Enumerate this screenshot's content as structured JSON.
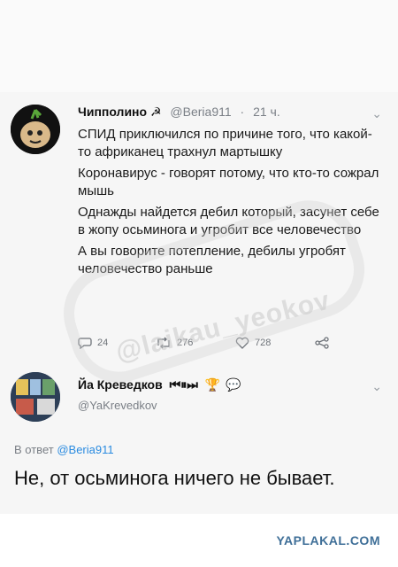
{
  "tweet1": {
    "name": "Чипполино",
    "handle": "@Beria911",
    "dot": "·",
    "time": "21 ч.",
    "lines": [
      "СПИД приключился  по причине того, что какой-то африканец трахнул мартышку",
      "Коронавирус - говорят потому, что кто-то сожрал мышь",
      "Однажды найдется дебил который, засунет себе в жопу осьминога и угробит все человечество",
      "А вы говорите потепление, дебилы угробят человечество раньше"
    ],
    "replies": "24",
    "retweets": "276",
    "likes": "728"
  },
  "tweet2": {
    "name": "Йа Креведков",
    "handle": "@YaKrevedkov",
    "reply_prefix": "В ответ",
    "reply_to": "@Beria911",
    "text": "Не, от осьминога ничего не бывает."
  },
  "watermark": "@laikau_yeokov",
  "site": "YAPLAKAL.COM",
  "icons": {
    "reply": "reply-icon",
    "retweet": "retweet-icon",
    "like": "heart-icon",
    "share": "share-icon",
    "chevron": "chevron-down-icon"
  },
  "colors": {
    "link": "#2a8be0",
    "meta": "#7a7f86",
    "site": "#3f6f98"
  }
}
